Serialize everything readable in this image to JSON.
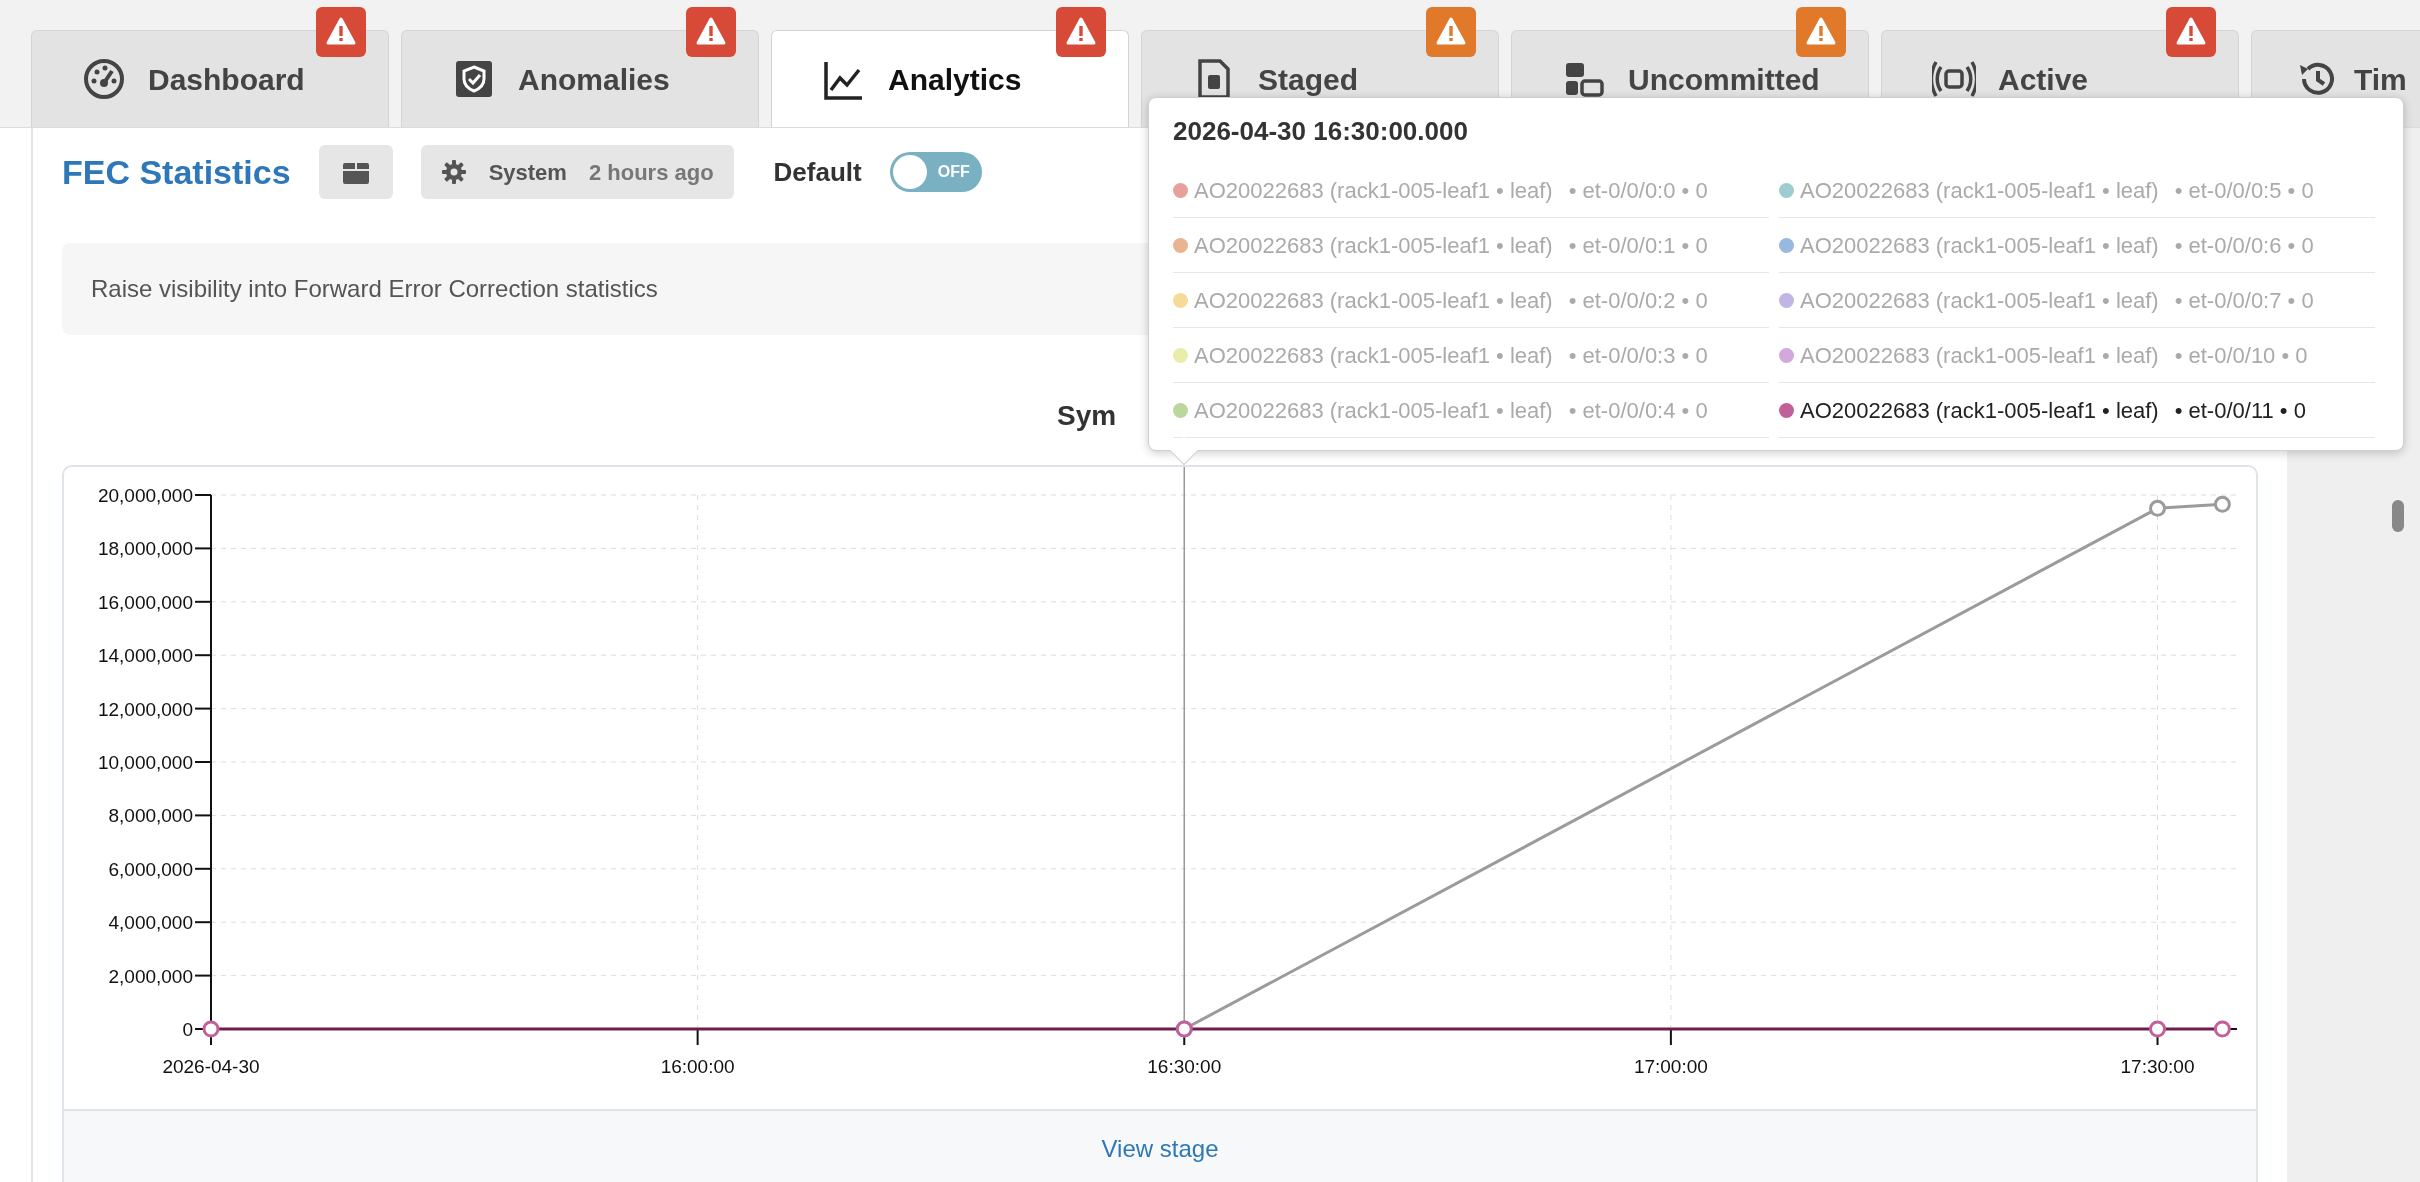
{
  "tabs": [
    {
      "label": "Dashboard",
      "selected": false,
      "color": "#d84a38"
    },
    {
      "label": "Anomalies",
      "selected": false,
      "color": "#d84a38"
    },
    {
      "label": "Analytics",
      "selected": true,
      "color": "#d84a38"
    },
    {
      "label": "Staged",
      "selected": false,
      "color": "#e07a2a"
    },
    {
      "label": "Uncommitted",
      "selected": false,
      "color": "#e07a2a"
    },
    {
      "label": "Active",
      "selected": false,
      "color": "#d84a38"
    },
    {
      "label": "Tim",
      "selected": false
    }
  ],
  "header": {
    "title": "FEC Statistics",
    "source": "System",
    "updated": "2 hours ago",
    "default_label": "Default",
    "default_toggle": {
      "on": false,
      "text": "OFF"
    }
  },
  "description": "Raise visibility into Forward Error Correction statistics",
  "chart": {
    "title": "Sym",
    "footer_link": "View stage",
    "chart_data": {
      "type": "line",
      "grid": true,
      "ref_lines": [
        {
          "axis": "x",
          "value": 59400,
          "color": "#999999"
        }
      ],
      "x": [
        55800,
        59400,
        63000,
        63240
      ],
      "xlim": [
        55800,
        63294
      ],
      "ylim": [
        0,
        20000000
      ],
      "xticks": [
        {
          "value": 55800,
          "label": "2026-04-30"
        },
        {
          "value": 57600,
          "label": "16:00:00"
        },
        {
          "value": 59400,
          "label": "16:30:00"
        },
        {
          "value": 61200,
          "label": "17:00:00"
        },
        {
          "value": 63000,
          "label": "17:30:00"
        }
      ],
      "yticks": [
        {
          "value": 0,
          "label": "0"
        },
        {
          "value": 2000000,
          "label": "2,000,000"
        },
        {
          "value": 4000000,
          "label": "4,000,000"
        },
        {
          "value": 6000000,
          "label": "6,000,000"
        },
        {
          "value": 8000000,
          "label": "8,000,000"
        },
        {
          "value": 10000000,
          "label": "10,000,000"
        },
        {
          "value": 12000000,
          "label": "12,000,000"
        },
        {
          "value": 14000000,
          "label": "14,000,000"
        },
        {
          "value": 16000000,
          "label": "16,000,000"
        },
        {
          "value": 18000000,
          "label": "18,000,000"
        },
        {
          "value": 20000000,
          "label": "20,000,000"
        }
      ],
      "series": [
        {
          "color": "#9b9b9b",
          "marker": "circle",
          "values": [
            null,
            0,
            19500000,
            19650000
          ]
        },
        {
          "color": "#c2609a",
          "marker": "circle",
          "values": [
            0,
            0,
            0,
            0
          ]
        }
      ]
    }
  },
  "tooltip": {
    "title": "2026-04-30 16:30:00.000",
    "columns": [
      [
        {
          "name": "AO20022683 (rack1-005-leaf1 • leaf)",
          "detail": "• et-0/0/0:0 • 0",
          "color": "#e8a09a",
          "highlighted": false
        },
        {
          "name": "AO20022683 (rack1-005-leaf1 • leaf)",
          "detail": "• et-0/0/0:1 • 0",
          "color": "#e9b48f",
          "highlighted": false
        },
        {
          "name": "AO20022683 (rack1-005-leaf1 • leaf)",
          "detail": "• et-0/0/0:2 • 0",
          "color": "#f8da98",
          "highlighted": false
        },
        {
          "name": "AO20022683 (rack1-005-leaf1 • leaf)",
          "detail": "• et-0/0/0:3 • 0",
          "color": "#e9eda8",
          "highlighted": false
        },
        {
          "name": "AO20022683 (rack1-005-leaf1 • leaf)",
          "detail": "• et-0/0/0:4 • 0",
          "color": "#bcd79c",
          "highlighted": false
        }
      ],
      [
        {
          "name": "AO20022683 (rack1-005-leaf1 • leaf)",
          "detail": "• et-0/0/0:5 • 0",
          "color": "#9dcdd0",
          "highlighted": false
        },
        {
          "name": "AO20022683 (rack1-005-leaf1 • leaf)",
          "detail": "• et-0/0/0:6 • 0",
          "color": "#96b9dd",
          "highlighted": false
        },
        {
          "name": "AO20022683 (rack1-005-leaf1 • leaf)",
          "detail": "• et-0/0/0:7 • 0",
          "color": "#c1b5e5",
          "highlighted": false
        },
        {
          "name": "AO20022683 (rack1-005-leaf1 • leaf)",
          "detail": "• et-0/0/10 • 0",
          "color": "#d3a8dc",
          "highlighted": false
        },
        {
          "name": "AO20022683 (rack1-005-leaf1 • leaf)",
          "detail": "• et-0/0/11 • 0",
          "color": "#c2609a",
          "highlighted": true
        }
      ]
    ]
  }
}
